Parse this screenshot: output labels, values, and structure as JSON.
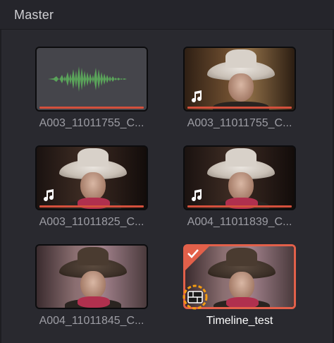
{
  "header": {
    "title": "Master"
  },
  "clips": [
    {
      "name": "A003_11011755_C...",
      "kind": "audio"
    },
    {
      "name": "A003_11011755_C...",
      "kind": "video",
      "audio_badge": "music-note-icon"
    },
    {
      "name": "A003_11011825_C...",
      "kind": "video",
      "audio_badge": "music-note-icon"
    },
    {
      "name": "A004_11011839_C...",
      "kind": "video",
      "audio_badge": "music-note-icon"
    },
    {
      "name": "A004_11011845_C...",
      "kind": "video"
    },
    {
      "name": "Timeline_test",
      "kind": "timeline",
      "selected": true,
      "badge": "timeline-icon",
      "highlight": "#f39c12"
    }
  ],
  "colors": {
    "accent": "#e2604a",
    "waveform": "#5aa35a",
    "highlight": "#f39c12"
  }
}
